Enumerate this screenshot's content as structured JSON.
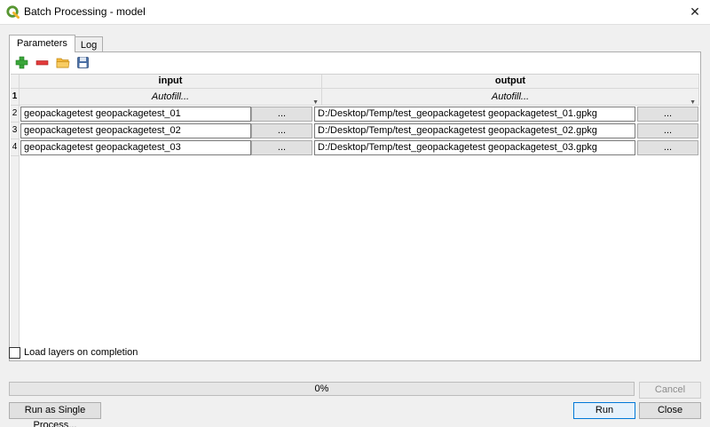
{
  "window": {
    "title": "Batch Processing - model",
    "close_glyph": "✕"
  },
  "tabs": [
    {
      "label": "Parameters",
      "active": true
    },
    {
      "label": "Log",
      "active": false
    }
  ],
  "toolbar": {
    "icons": [
      "add-row-icon",
      "remove-row-icon",
      "open-folder-icon",
      "save-icon"
    ]
  },
  "table": {
    "columns": [
      "input",
      "output"
    ],
    "autofill_row": {
      "number": "1",
      "input_label": "Autofill...",
      "output_label": "Autofill..."
    },
    "rows": [
      {
        "number": "2",
        "input": "geopackagetest geopackagetest_01",
        "output": "D:/Desktop/Temp/test_geopackagetest geopackagetest_01.gpkg"
      },
      {
        "number": "3",
        "input": "geopackagetest geopackagetest_02",
        "output": "D:/Desktop/Temp/test_geopackagetest geopackagetest_02.gpkg"
      },
      {
        "number": "4",
        "input": "geopackagetest geopackagetest_03",
        "output": "D:/Desktop/Temp/test_geopackagetest geopackagetest_03.gpkg"
      }
    ],
    "browse_label": "..."
  },
  "load_layers": {
    "label": "Load layers on completion",
    "checked": false
  },
  "progress": {
    "value": 0,
    "text": "0%"
  },
  "buttons": {
    "cancel": "Cancel",
    "run_single": "Run as Single Process...",
    "run": "Run",
    "close": "Close"
  },
  "colors": {
    "accent": "#0078d7",
    "add_icon": "#3aa63a",
    "remove_icon": "#e23b3b",
    "folder_icon": "#f4b83a",
    "save_icon": "#4a6fa5"
  }
}
